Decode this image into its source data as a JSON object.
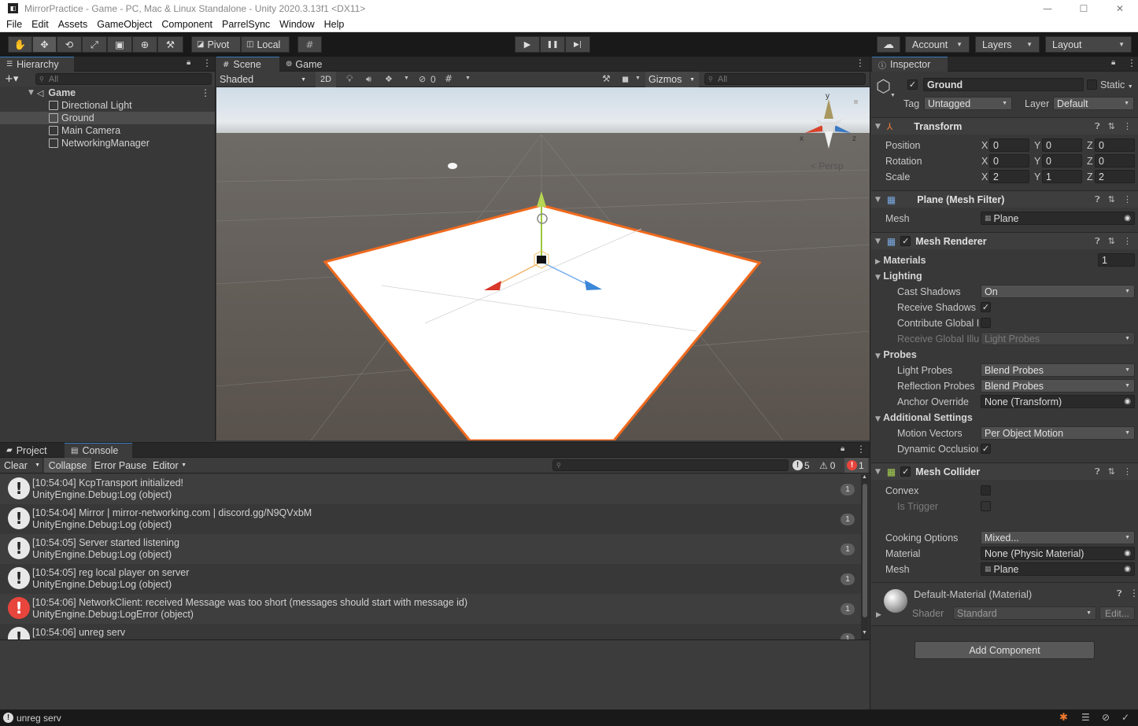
{
  "window": {
    "title": "MirrorPractice - Game - PC, Mac & Linux Standalone - Unity 2020.3.13f1 <DX11>",
    "logo_glyph": "◧",
    "minimize": "—",
    "maximize": "☐",
    "close": "✕"
  },
  "menu": [
    "File",
    "Edit",
    "Assets",
    "GameObject",
    "Component",
    "ParrelSync",
    "Window",
    "Help"
  ],
  "toolbar": {
    "tools": [
      "✋",
      "✥",
      "⟲",
      "⤢",
      "▣",
      "⊕",
      "⚒"
    ],
    "pivot": "Pivot",
    "local": "Local",
    "grid_icon": "#",
    "play": "▶",
    "pause": "❚❚",
    "step": "▶|",
    "cloud": "☁",
    "account": "Account",
    "layers": "Layers",
    "layout": "Layout"
  },
  "hierarchy": {
    "tab": "Hierarchy",
    "add": "+▾",
    "search_placeholder": "All",
    "scene": "Game",
    "items": [
      "Directional Light",
      "Ground",
      "Main Camera",
      "NetworkingManager"
    ],
    "selected_index": 1
  },
  "scene_view": {
    "tabs": [
      "Scene",
      "Game"
    ],
    "shading": "Shaded",
    "mode_2d": "2D",
    "hidden_count": "0",
    "gizmos": "Gizmos",
    "search_placeholder": "All",
    "persp": "Persp",
    "gizmo_axes": [
      "x",
      "y",
      "z"
    ]
  },
  "inspector": {
    "tab": "Inspector",
    "object_name": "Ground",
    "static_label": "Static",
    "tag_label": "Tag",
    "tag_value": "Untagged",
    "layer_label": "Layer",
    "layer_value": "Default",
    "transform": {
      "title": "Transform",
      "position_label": "Position",
      "rotation_label": "Rotation",
      "scale_label": "Scale",
      "position": [
        "0",
        "0",
        "0"
      ],
      "rotation": [
        "0",
        "0",
        "0"
      ],
      "scale": [
        "2",
        "1",
        "2"
      ],
      "axis_labels": [
        "X",
        "Y",
        "Z"
      ]
    },
    "mesh_filter": {
      "title": "Plane (Mesh Filter)",
      "mesh_label": "Mesh",
      "mesh_value": "Plane"
    },
    "mesh_renderer": {
      "title": "Mesh Renderer",
      "materials_label": "Materials",
      "materials_count": "1",
      "lighting": "Lighting",
      "cast_shadows_label": "Cast Shadows",
      "cast_shadows_value": "On",
      "receive_shadows_label": "Receive Shadows",
      "contribute_gi_label": "Contribute Global I",
      "receive_gi_label": "Receive Global Illu",
      "receive_gi_value": "Light Probes",
      "probes": "Probes",
      "light_probes_label": "Light Probes",
      "light_probes_value": "Blend Probes",
      "reflection_probes_label": "Reflection Probes",
      "reflection_probes_value": "Blend Probes",
      "anchor_override_label": "Anchor Override",
      "anchor_override_value": "None (Transform)",
      "additional": "Additional Settings",
      "motion_vectors_label": "Motion Vectors",
      "motion_vectors_value": "Per Object Motion",
      "dynamic_occlusion_label": "Dynamic Occlusioı"
    },
    "mesh_collider": {
      "title": "Mesh Collider",
      "convex_label": "Convex",
      "trigger_label": "Is Trigger",
      "cooking_label": "Cooking Options",
      "cooking_value": "Mixed...",
      "material_label": "Material",
      "material_value": "None (Physic Material)",
      "mesh_label": "Mesh",
      "mesh_value": "Plane"
    },
    "material": {
      "title": "Default-Material (Material)",
      "shader_label": "Shader",
      "shader_value": "Standard",
      "edit": "Edit..."
    },
    "add_component": "Add Component"
  },
  "console": {
    "tabs": [
      "Project",
      "Console"
    ],
    "buttons": [
      "Clear",
      "Collapse",
      "Error Pause",
      "Editor"
    ],
    "counts": {
      "log": "5",
      "warn": "0",
      "error": "1"
    },
    "entries": [
      {
        "type": "log",
        "line1": "[10:54:04] KcpTransport initialized!",
        "line2": "UnityEngine.Debug:Log (object)",
        "count": "1"
      },
      {
        "type": "log",
        "line1": "[10:54:04] Mirror | mirror-networking.com | discord.gg/N9QVxbM",
        "line2": "UnityEngine.Debug:Log (object)",
        "count": "1"
      },
      {
        "type": "log",
        "line1": "[10:54:05] Server started listening",
        "line2": "UnityEngine.Debug:Log (object)",
        "count": "1"
      },
      {
        "type": "log",
        "line1": "[10:54:05] reg local player on server",
        "line2": "UnityEngine.Debug:Log (object)",
        "count": "1"
      },
      {
        "type": "error",
        "line1": "[10:54:06] NetworkClient: received Message was too short (messages should start with message id)",
        "line2": "UnityEngine.Debug:LogError (object)",
        "count": "1"
      },
      {
        "type": "log",
        "line1": "[10:54:06] unreg serv",
        "line2": "",
        "count": "1"
      }
    ]
  },
  "status_bar": {
    "message": "unreg serv"
  }
}
